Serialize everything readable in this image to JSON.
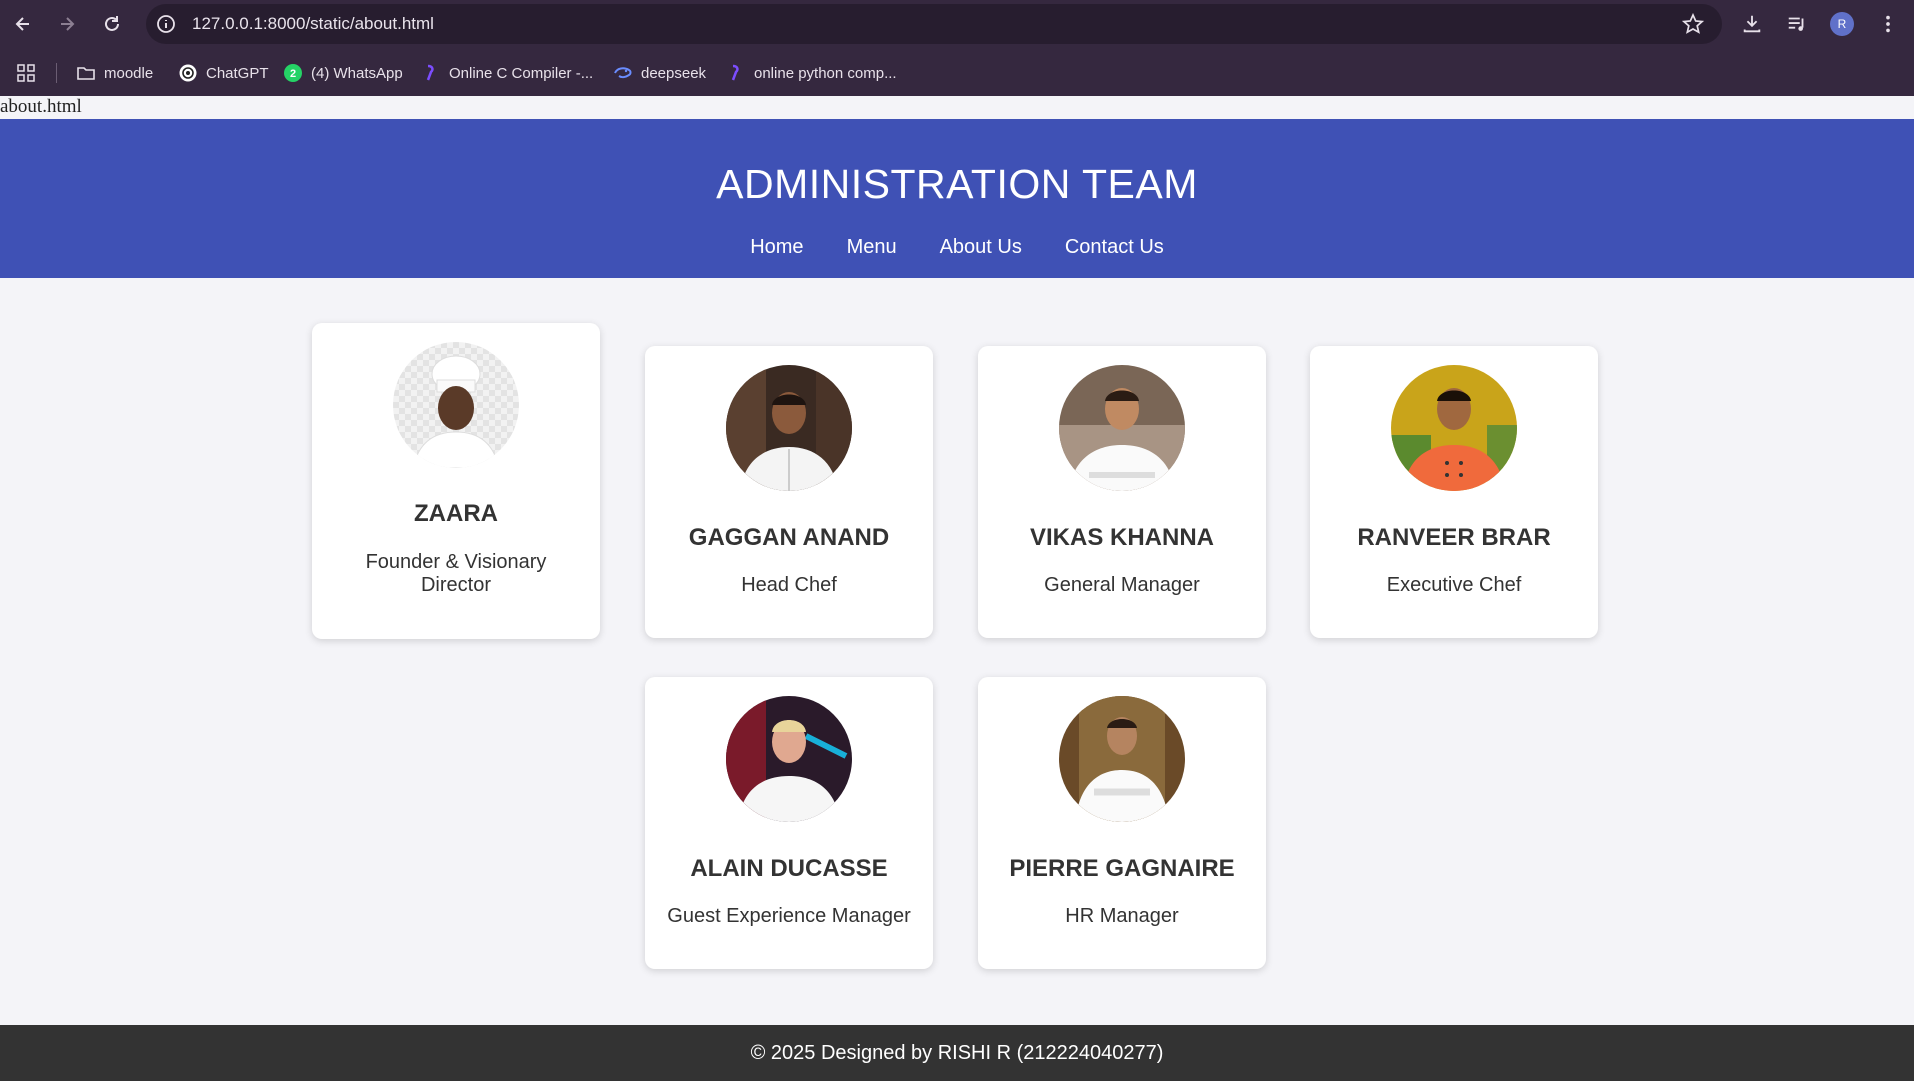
{
  "browser": {
    "url": "127.0.0.1:8000/static/about.html",
    "avatar_letter": "R",
    "bookmarks": [
      {
        "label": "moodle",
        "icon": "folder-icon"
      },
      {
        "label": "ChatGPT",
        "icon": "chatgpt-icon"
      },
      {
        "label": "(4) WhatsApp",
        "icon": "whatsapp-icon"
      },
      {
        "label": "Online C Compiler -...",
        "icon": "compiler-icon"
      },
      {
        "label": "deepseek",
        "icon": "deepseek-icon"
      },
      {
        "label": "online python comp...",
        "icon": "compiler-icon"
      }
    ]
  },
  "page": {
    "loose_text": "about.html",
    "header": {
      "title": "ADMINISTRATION TEAM",
      "nav": [
        "Home",
        "Menu",
        "About Us",
        "Contact Us"
      ]
    },
    "team": [
      {
        "name": "ZAARA",
        "role": "Founder & Visionary Director"
      },
      {
        "name": "GAGGAN ANAND",
        "role": "Head Chef"
      },
      {
        "name": "VIKAS KHANNA",
        "role": "General Manager"
      },
      {
        "name": "RANVEER BRAR",
        "role": "Executive Chef"
      },
      {
        "name": "ALAIN DUCASSE",
        "role": "Guest Experience Manager"
      },
      {
        "name": "PIERRE GAGNAIRE",
        "role": "HR Manager"
      }
    ],
    "footer": "© 2025 Designed by RISHI R (212224040277)"
  },
  "colors": {
    "header_bg": "#3f51b5",
    "footer_bg": "#333333",
    "page_bg": "#f4f4f8",
    "chrome_bg": "#35283f"
  }
}
